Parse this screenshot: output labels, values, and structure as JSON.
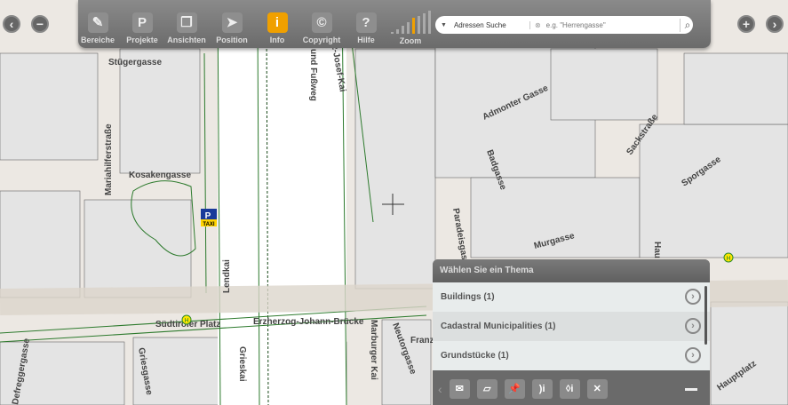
{
  "toolbar": {
    "items": [
      {
        "label": "Bereiche",
        "icon": "ruler-icon",
        "glyph": "✎"
      },
      {
        "label": "Projekte",
        "icon": "projects-icon",
        "glyph": "P"
      },
      {
        "label": "Ansichten",
        "icon": "views-icon",
        "glyph": "❐"
      },
      {
        "label": "Position",
        "icon": "location-arrow-icon",
        "glyph": "➤"
      },
      {
        "label": "Info",
        "icon": "info-icon",
        "glyph": "i"
      },
      {
        "label": "Copyright",
        "icon": "copyright-icon",
        "glyph": "©"
      },
      {
        "label": "Hilfe",
        "icon": "help-icon",
        "glyph": "?"
      }
    ],
    "zoom_label": "Zoom",
    "zoom_level": 0.55
  },
  "search": {
    "mode": "Adressen Suche",
    "placeholder": "e.g. \"Herrengasse\""
  },
  "map": {
    "labels": [
      "Stügergasse",
      "Mariahilferstraße",
      "Kosakengasse",
      "Lendkai",
      "Südtiroler Platz",
      "Erzherzog-Johann-Brücke",
      "Franz-Josef-Kai",
      "Rad- und Fußweg",
      "Admonter Gasse",
      "Badgasse",
      "Sackstraße",
      "Sporgasse",
      "Paradeisgasse",
      "Murgasse",
      "Hauptplatz",
      "Marburger Kai",
      "Neutorgasse",
      "Griesgasse",
      "Grieskai",
      "Defreggergasse",
      "Hau",
      "Franz"
    ],
    "taxi": "TAXI",
    "parking": "P",
    "bus": "H"
  },
  "panel": {
    "title": "Wählen Sie ein Thema",
    "rows": [
      "Buildings (1)",
      "Cadastral Municipalities (1)",
      "Grundstücke (1)"
    ]
  },
  "accent": "#f0a000"
}
